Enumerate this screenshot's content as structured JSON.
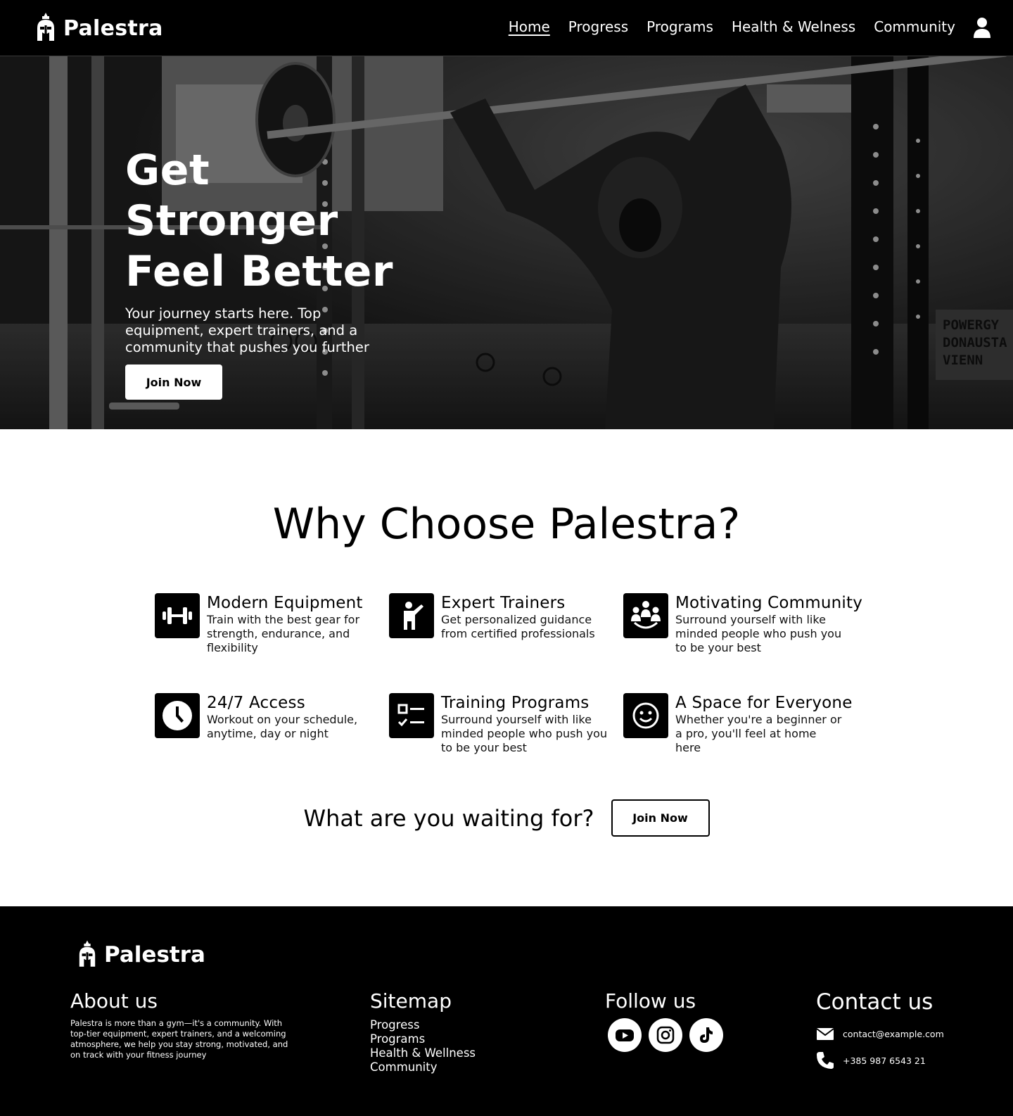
{
  "nav": {
    "brand": "Palestra",
    "links": [
      "Home",
      "Progress",
      "Programs",
      "Health & Welness",
      "Community"
    ],
    "active": "Home"
  },
  "hero": {
    "title_line1": "Get Stronger",
    "title_line2": "Feel Better",
    "subtitle": "Your journey starts here. Top equipment, expert trainers, and a community that pushes you further",
    "cta": "Join Now",
    "sign_text": [
      "POWERGY",
      "DONAUSTA",
      "VIENN"
    ]
  },
  "why": {
    "title": "Why Choose Palestra?",
    "features": [
      {
        "icon": "dumbbell-icon",
        "title": "Modern Equipment",
        "desc": "Train with the best gear for strength, endurance, and flexibility"
      },
      {
        "icon": "trainer-icon",
        "title": "Expert Trainers",
        "desc": "Get personalized guidance from certified professionals"
      },
      {
        "icon": "community-icon",
        "title": "Motivating Community",
        "desc": "Surround yourself with like minded people who push you to be your best"
      },
      {
        "icon": "clock-icon",
        "title": "24/7 Access",
        "desc": "Workout on your schedule, anytime, day or night"
      },
      {
        "icon": "checklist-icon",
        "title": "Training Programs",
        "desc": "Surround yourself with like minded people who push you to be your best"
      },
      {
        "icon": "smiley-icon",
        "title": "A Space for Everyone",
        "desc": "Whether you're a beginner or a pro, you'll feel at home here"
      }
    ]
  },
  "cta": {
    "text": "What are you waiting for?",
    "button": "Join Now"
  },
  "footer": {
    "brand": "Palestra",
    "about": {
      "title": "About us",
      "text": "Palestra is more than a gym—it's a community. With top-tier equipment, expert trainers, and a welcoming atmosphere, we help you stay strong, motivated, and on track with your fitness journey"
    },
    "sitemap": {
      "title": "Sitemap",
      "links": [
        "Progress",
        "Programs",
        "Health & Wellness",
        "Community"
      ]
    },
    "follow": {
      "title": "Follow us",
      "icons": [
        "youtube-icon",
        "instagram-icon",
        "tiktok-icon"
      ]
    },
    "contact": {
      "title": "Contact us",
      "email": "contact@example.com",
      "phone": "+385 987 6543 21"
    }
  }
}
